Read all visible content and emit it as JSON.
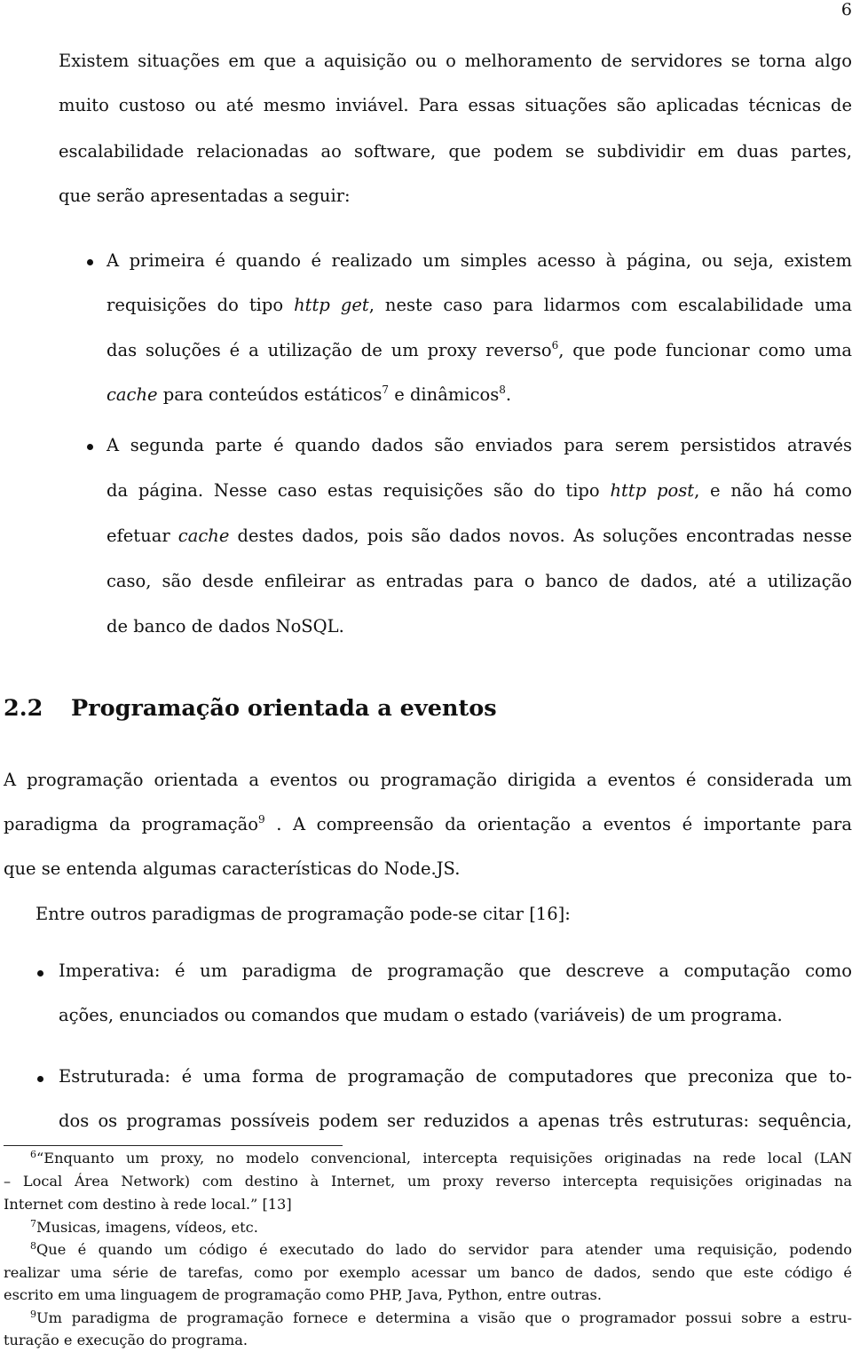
{
  "page": {
    "number": "6"
  },
  "intro": {
    "lines": [
      "Existem situações em que a aquisição ou o melhoramento de servidores se torna algo",
      "muito custoso ou até mesmo inviável. Para essas situações são aplicadas técnicas de",
      "escalabilidade relacionadas ao software, que podem se subdividir em duas partes,",
      "que serão apresentadas a seguir:"
    ]
  },
  "bullets1": [
    {
      "l1": "A primeira é quando é realizado um simples acesso à página, ou seja, existem",
      "l2_a": "requisições do tipo ",
      "l2_em": "http get",
      "l2_b": ", neste caso para lidarmos com escalabilidade uma",
      "l3_a": "das soluções é a utilização de um proxy reverso",
      "l3_sup": "6",
      "l3_b": ", que pode funcionar como uma",
      "l4_em": "cache",
      "l4_a": " para conteúdos estáticos",
      "l4_sup1": "7",
      "l4_b": " e dinâmicos",
      "l4_sup2": "8",
      "l4_c": "."
    },
    {
      "l1": "A segunda parte é quando dados são enviados para serem persistidos através",
      "l2_a": "da página. Nesse caso estas requisições são do tipo ",
      "l2_em": "http post",
      "l2_b": ", e não há como",
      "l3_a": "efetuar ",
      "l3_em": "cache",
      "l3_b": " destes dados, pois são dados novos. As soluções encontradas nesse",
      "l4": "caso, são desde enfileirar as entradas para o banco de dados, até a utilização",
      "l5": "de banco de dados NoSQL."
    }
  ],
  "section": {
    "number": "2.2",
    "title": "Programação orientada a eventos",
    "p1_l1": "A programação orientada a eventos ou programação dirigida a eventos é considerada um",
    "p1_l2_a": "paradigma da programação",
    "p1_l2_sup": "9",
    "p1_l2_b": " . A compreensão da orientação a eventos é importante para",
    "p1_l3": "que se entenda algumas características do Node.JS.",
    "p2": "Entre outros paradigmas de programação pode-se citar [16]:"
  },
  "bullets2": [
    {
      "l1": "Imperativa: é um paradigma de programação que descreve a computação como",
      "l2": "ações, enunciados ou comandos que mudam o estado (variáveis) de um programa."
    },
    {
      "l1": "Estruturada: é uma forma de programação de computadores que preconiza que to-",
      "l2": "dos os programas possíveis podem ser reduzidos a apenas três estruturas: sequência,"
    }
  ],
  "footnotes": [
    {
      "mark": "6",
      "lines": [
        "“Enquanto um proxy, no modelo convencional, intercepta requisições originadas na rede local (LAN",
        "– Local Área Network) com destino à Internet, um proxy reverso intercepta requisições originadas na",
        "Internet com destino à rede local.” [13]"
      ]
    },
    {
      "mark": "7",
      "lines": [
        "Musicas, imagens, vídeos, etc."
      ]
    },
    {
      "mark": "8",
      "lines": [
        "Que é quando um código é executado do lado do servidor para atender uma requisição, podendo",
        "realizar uma série de tarefas, como por exemplo acessar um banco de dados, sendo que este código é",
        "escrito em uma linguagem de programação como PHP, Java, Python, entre outras."
      ]
    },
    {
      "mark": "9",
      "lines": [
        "Um paradigma de programação fornece e determina a visão que o programador possui sobre a estru-",
        "turação e execução do programa."
      ]
    }
  ]
}
